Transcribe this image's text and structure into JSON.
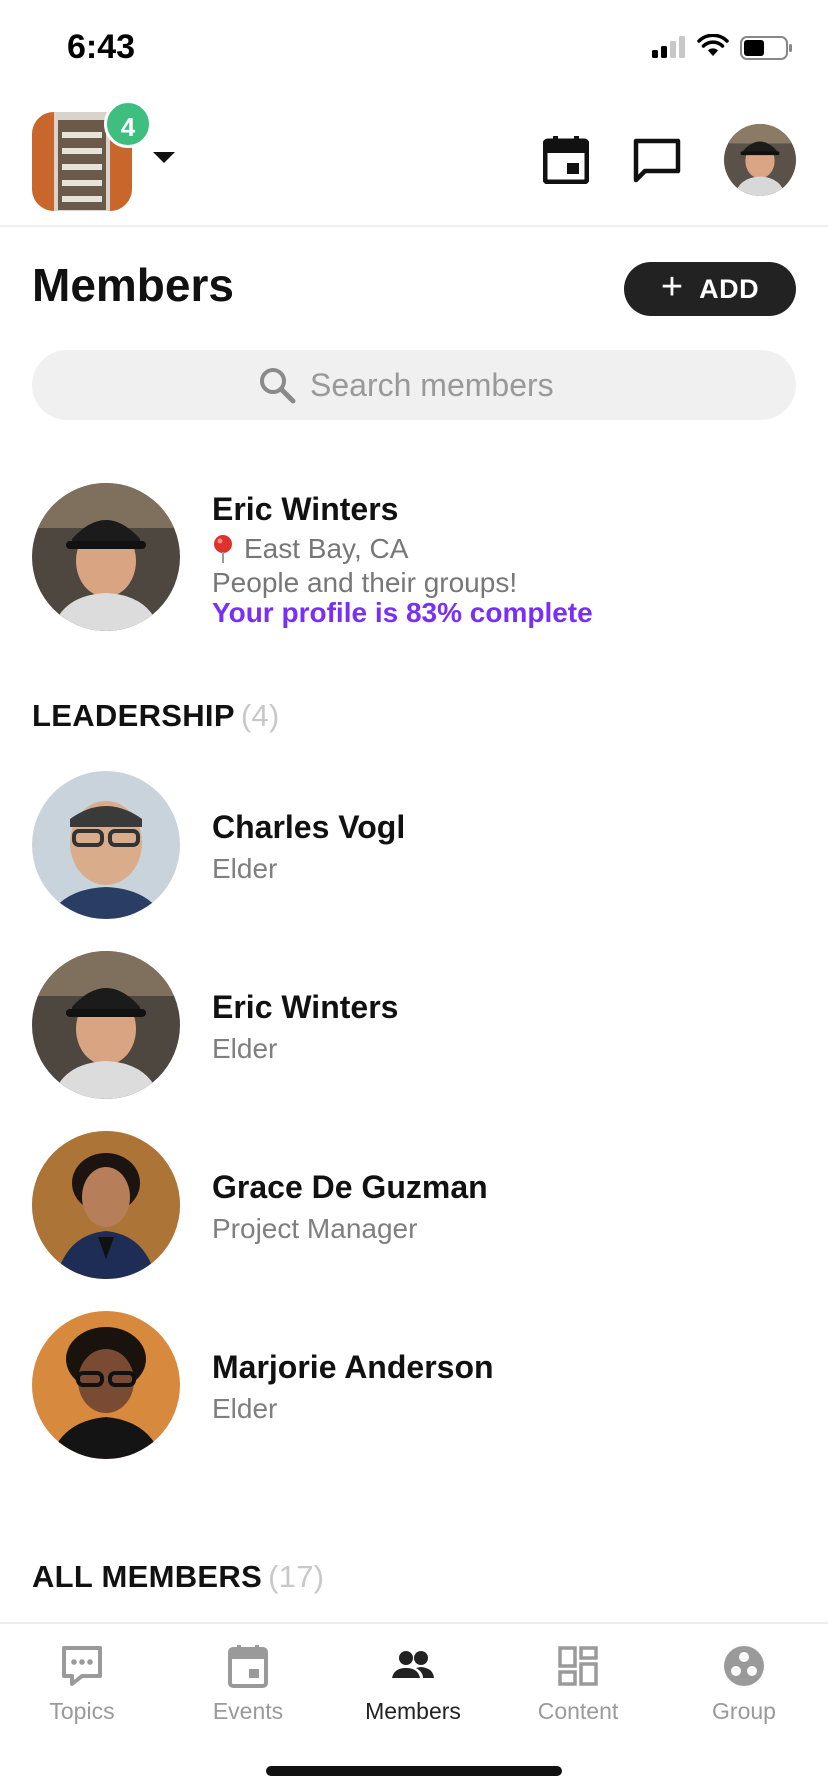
{
  "status_bar": {
    "time": "6:43"
  },
  "header": {
    "notification_count": "4"
  },
  "page": {
    "title": "Members",
    "add_label": "ADD"
  },
  "search": {
    "placeholder": "Search members"
  },
  "me": {
    "name": "Eric Winters",
    "location": "East Bay, CA",
    "tagline": "People and their groups!",
    "profile_progress": "Your profile is 83% complete"
  },
  "leadership": {
    "title": "LEADERSHIP",
    "count": "(4)",
    "members": [
      {
        "name": "Charles Vogl",
        "role": "Elder"
      },
      {
        "name": "Eric Winters",
        "role": "Elder"
      },
      {
        "name": "Grace De Guzman",
        "role": "Project Manager"
      },
      {
        "name": "Marjorie Anderson",
        "role": "Elder"
      }
    ]
  },
  "all_members": {
    "title": "ALL MEMBERS",
    "count": "(17)"
  },
  "tabs": [
    {
      "label": "Topics",
      "icon": "chat-bubble-icon",
      "active": false
    },
    {
      "label": "Events",
      "icon": "calendar-icon",
      "active": false
    },
    {
      "label": "Members",
      "icon": "people-icon",
      "active": true
    },
    {
      "label": "Content",
      "icon": "dashboard-icon",
      "active": false
    },
    {
      "label": "Group",
      "icon": "group-icon",
      "active": false
    }
  ],
  "colors": {
    "accent_purple": "#7a2ff7",
    "badge_green": "#3fbf7f",
    "add_button_bg": "#222222"
  }
}
